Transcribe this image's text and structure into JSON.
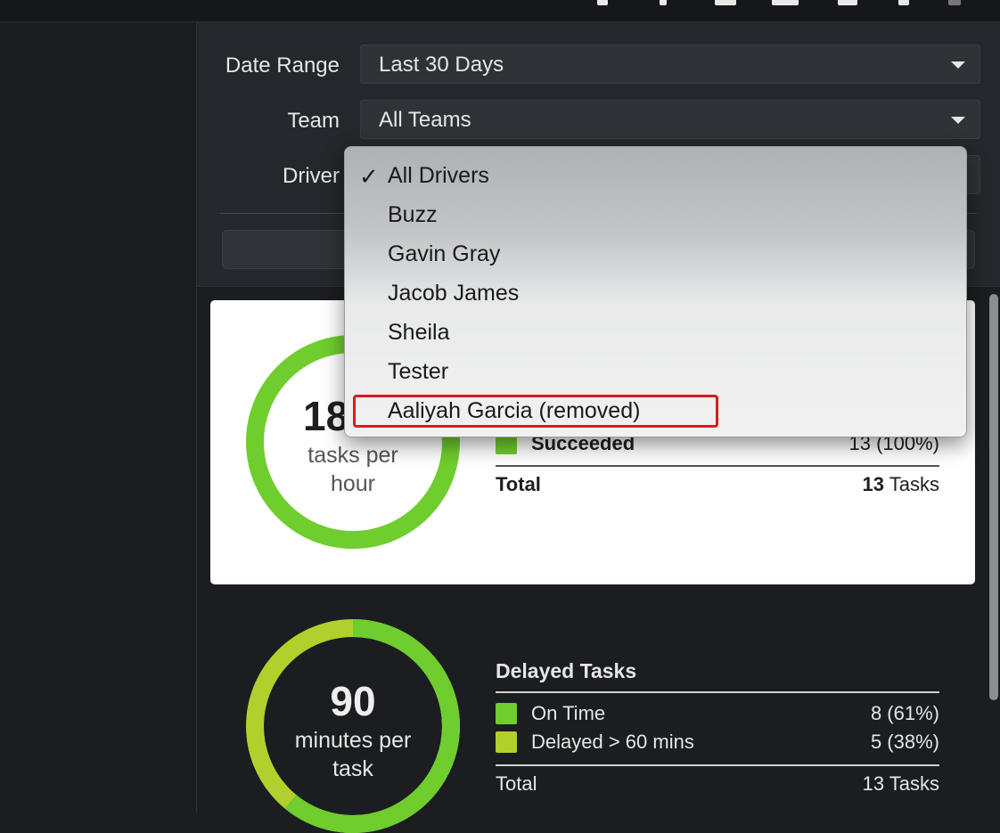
{
  "filters": {
    "date_range": {
      "label": "Date Range",
      "value": "Last 30 Days"
    },
    "team": {
      "label": "Team",
      "value": "All Teams"
    },
    "driver": {
      "label": "Driver"
    }
  },
  "driver_dropdown": {
    "selected": "All Drivers",
    "options": [
      "All Drivers",
      "Buzz",
      "Gavin Gray",
      "Jacob James",
      "Sheila",
      "Tester",
      "Aaliyah Garcia (removed)"
    ]
  },
  "card_tasks": {
    "value": "18",
    "unit_line1": "tasks per",
    "unit_line2": "hour",
    "succeeded_label": "Succeeded",
    "succeeded_value": "13 (100%)",
    "total_label": "Total",
    "total_count": "13",
    "total_unit": "Tasks",
    "gauge_fraction": 1.0
  },
  "card_delay": {
    "value": "90",
    "unit_line1": "minutes per",
    "unit_line2": "task",
    "title": "Delayed Tasks",
    "rows": [
      {
        "label": "On Time",
        "value": "8 (61%)",
        "color": "#6fcd2e"
      },
      {
        "label": "Delayed > 60 mins",
        "value": "5 (38%)",
        "color": "#b3cf2c"
      }
    ],
    "total_label": "Total",
    "total_value": "13 Tasks",
    "on_time_fraction": 0.61
  },
  "colors": {
    "green": "#6fcd2e",
    "yellow_green": "#b3cf2c",
    "highlight": "#d91c1c"
  }
}
